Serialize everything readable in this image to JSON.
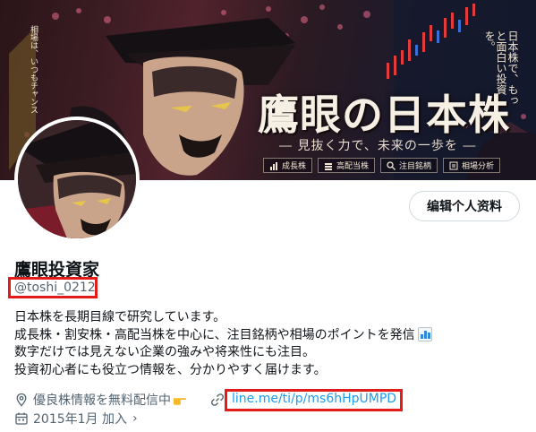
{
  "banner": {
    "title": "鷹眼の日本株",
    "subtitle": "― 見抜く力で、未来の一歩を ―",
    "left_caption": "相場は、いつもチャンス",
    "right_caption": "日本株で、もっと面白い投資を。",
    "tags": [
      "成長株",
      "高配当株",
      "注目銘柄",
      "相場分析"
    ]
  },
  "profile": {
    "display_name": "鷹眼投資家",
    "handle": "@toshi_0212",
    "edit_button": "编辑个人资料",
    "bio": [
      "日本株を長期目線で研究しています。",
      "成長株・割安株・高配当株を中心に、注目銘柄や相場のポイントを発信",
      "数字だけでは見えない企業の強みや将来性にも注目。",
      "投資初心者にも役立つ情報を、分かりやすく届けます。"
    ],
    "location": "優良株情報を無料配信中",
    "website": "line.me/ti/p/ms6hHpUMPD",
    "joined": "2015年1月 加入"
  },
  "colors": {
    "link": "#1d9bf0",
    "secondary_text": "#536471",
    "highlight_border": "#e41b1b"
  },
  "icons": [
    "location-icon",
    "link-icon",
    "calendar-icon",
    "pointing-hand-icon",
    "chart-emoji-icon"
  ]
}
